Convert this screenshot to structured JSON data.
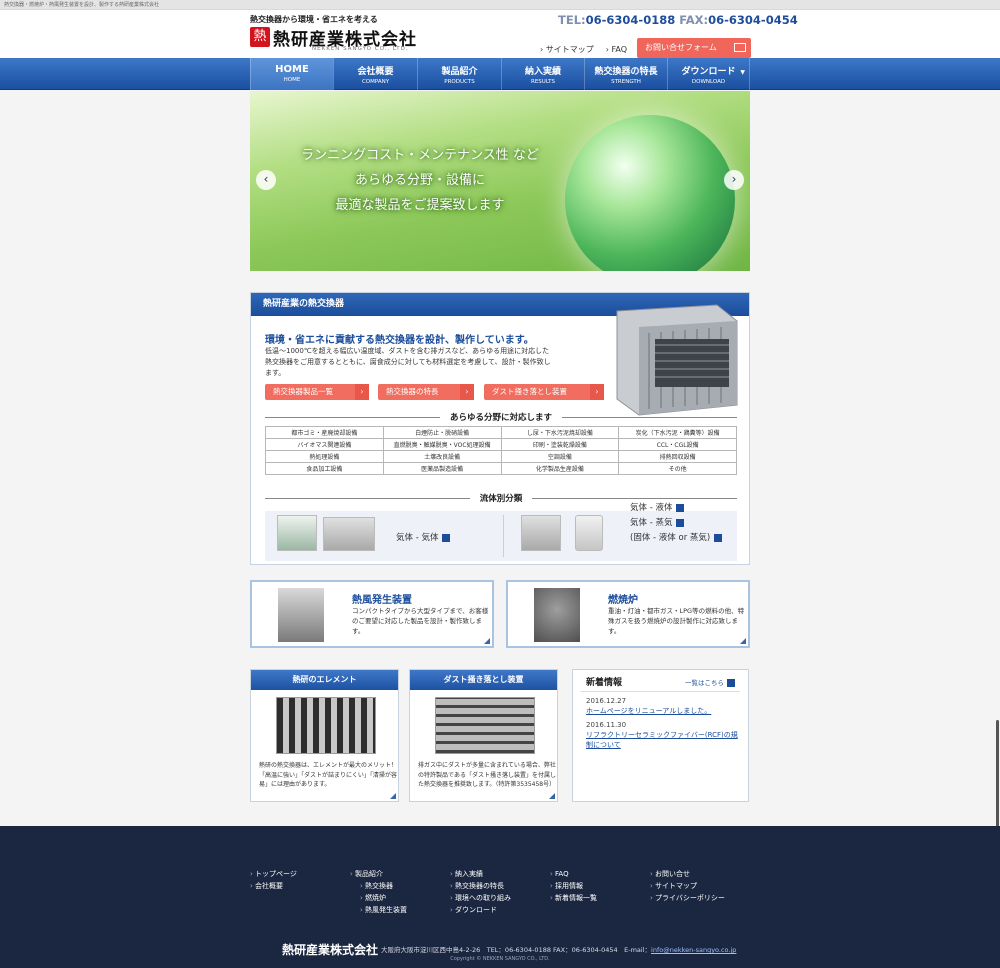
{
  "strip": {
    "text": "熱交換器・燃焼炉・熱風発生装置を設計、製作する熱研産業株式会社"
  },
  "logo": {
    "tagline": "熱交換器から環境・省エネを考える",
    "name": "熱研産業株式会社",
    "name_en": "NEKKEN SANGYO CO., LTD.",
    "mark": "熱"
  },
  "header": {
    "tel_label": "TEL:",
    "tel": "06-6304-0188",
    "fax_label": "FAX:",
    "fax": "06-6304-0454",
    "sitemap": "› サイトマップ",
    "faq": "› FAQ",
    "contact": "お問い合せフォーム"
  },
  "nav": [
    {
      "jp": "HOME",
      "en": "HOME"
    },
    {
      "jp": "会社概要",
      "en": "COMPANY"
    },
    {
      "jp": "製品紹介",
      "en": "PRODUCTS"
    },
    {
      "jp": "納入実績",
      "en": "RESULTS"
    },
    {
      "jp": "熱交換器の特長",
      "en": "STRENGTH"
    },
    {
      "jp": "ダウンロード",
      "en": "DOWNLOAD"
    }
  ],
  "hero": {
    "line1": "ランニングコスト・メンテナンス性 など",
    "line2": "あらゆる分野・設備に",
    "line3": "最適な製品をご提案致します",
    "prev": "‹",
    "next": "›"
  },
  "hx": {
    "title": "熱研産業の熱交換器",
    "lead": "環境・省エネに貢献する熱交換器を設計、製作しています。",
    "desc": "低温〜1000℃を超える幅広い温度域、ダストを含む排ガスなど、あらゆる用途に対応した熱交換器をご用意するとともに、腐食成分に対しても材料選定を考慮して、設計・製作致します。",
    "buttons": [
      "熱交換器製品一覧",
      "熱交換器の特長",
      "ダスト掻き落とし装置"
    ],
    "fields_title": "あらゆる分野に対応します",
    "fields": [
      [
        "都市ゴミ・産廃焼却設備",
        "白煙防止・脱硝設備",
        "し尿・下水汚泥焼却設備",
        "炭化（下水汚泥・鶏糞等）設備"
      ],
      [
        "バイオマス関連設備",
        "直燃脱臭・触媒脱臭・VOC処理設備",
        "印刷・塗装乾燥設備",
        "CCL・CGL設備"
      ],
      [
        "熱処理設備",
        "土壌改良設備",
        "空調設備",
        "排熱回収設備"
      ],
      [
        "食品加工設備",
        "医薬品製造設備",
        "化学製品生産設備",
        "その他"
      ]
    ],
    "fluid_title": "流体別分類",
    "gas_gas": "気体 - 気体",
    "gas_liquid": "気体 - 液体",
    "gas_steam": "気体 - 蒸気",
    "solid": "(固体 - 液体 or 蒸気)"
  },
  "products": [
    {
      "title": "熱風発生装置",
      "text": "コンパクトタイプから大型タイプまで、お客様のご要望に対応した製品を設計・製作致します。"
    },
    {
      "title": "燃焼炉",
      "text": "重油・灯油・都市ガス・LPG等の燃料の他、特殊ガスを扱う燃焼炉の設計製作に対応致します。"
    }
  ],
  "element": {
    "title": "熱研のエレメント",
    "text": "熱研の熱交換器は、エレメントが最大のメリット！「高温に強い」「ダストが詰まりにくい」「清掃が容易」には理由があります。"
  },
  "dust": {
    "title": "ダスト掻き落とし装置",
    "text": "排ガス中にダストが多量に含まれている場合、弊社の特許製品である「ダスト掻き落し装置」を付属した熱交換器を推奨致します。（特許第3535458号）"
  },
  "news": {
    "title": "新着情報",
    "more": "一覧はこちら",
    "items": [
      {
        "date": "2016.12.27",
        "text": "ホームページをリニューアルしました。"
      },
      {
        "date": "2016.11.30",
        "text": "リフラクトリーセラミックファイバー(RCF)の規制について"
      }
    ]
  },
  "footer": {
    "col1": [
      "トップページ",
      "会社概要"
    ],
    "col2": [
      "製品紹介",
      "熱交換器",
      "燃焼炉",
      "熱風発生装置"
    ],
    "col3": [
      "納入実績",
      "熱交換器の特長",
      "環境への取り組み",
      "ダウンロード"
    ],
    "col4": [
      "FAQ",
      "採用情報",
      "新着情報一覧"
    ],
    "col5": [
      "お問い合せ",
      "サイトマップ",
      "プライバシーポリシー"
    ],
    "company": "熱研産業株式会社",
    "address": "大阪府大阪市淀川区西中島4-2-26　TEL：06-6304-0188 FAX：06-6304-0454　E-mail：",
    "email": "info@nekken-sangyo.co.jp",
    "copyright": "Copyright © NEKKEN SANGYO CO., LTD."
  }
}
